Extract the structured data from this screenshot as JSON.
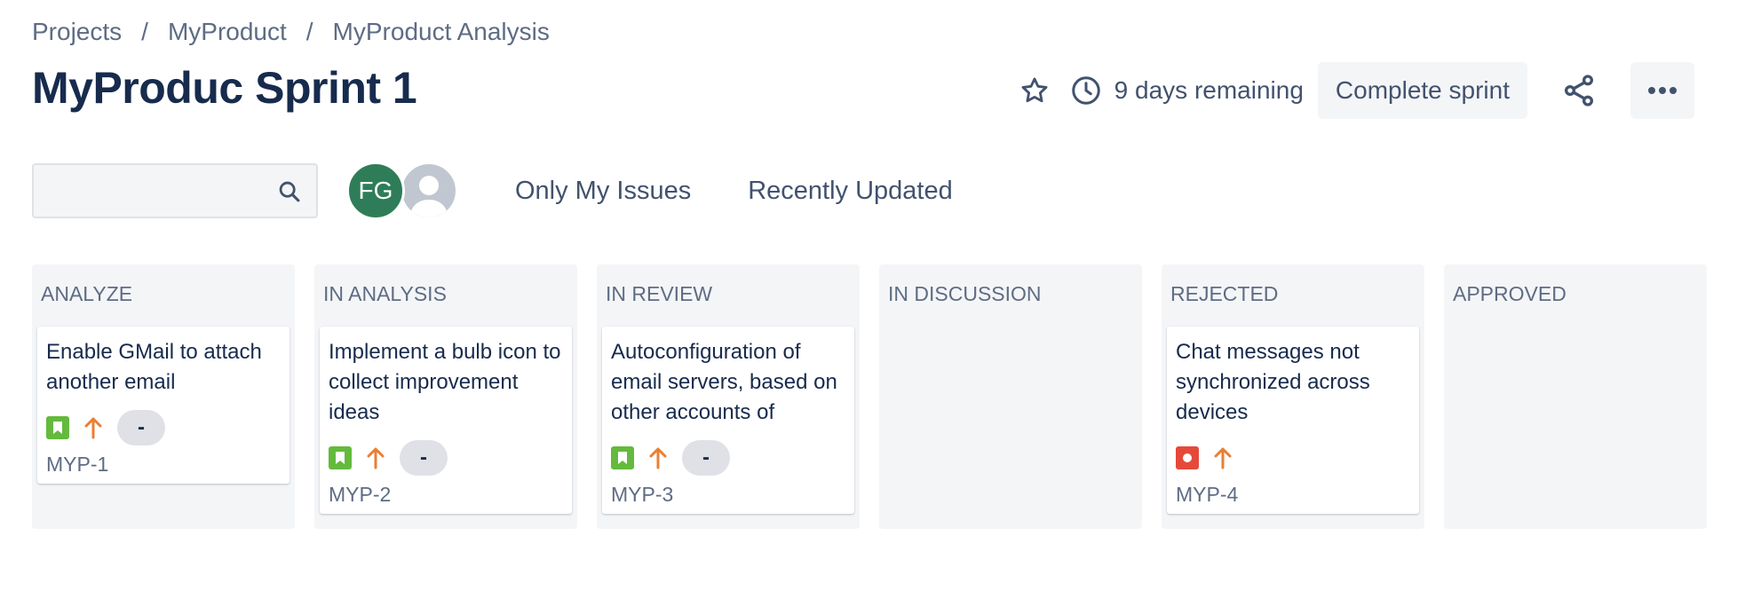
{
  "breadcrumb": {
    "items": [
      "Projects",
      "MyProduct",
      "MyProduct Analysis"
    ],
    "separator": "/"
  },
  "page_title": "MyProduc Sprint 1",
  "header": {
    "star_icon": "star-icon",
    "remaining": "9 days remaining",
    "complete_sprint": "Complete sprint",
    "share_icon": "share-icon",
    "more_icon": "more-icon"
  },
  "search": {
    "placeholder": "",
    "value": ""
  },
  "avatars": [
    {
      "initials": "FG",
      "color": "#2e7d58"
    },
    {
      "initials": "",
      "color": "#c1c7d0"
    }
  ],
  "filters": {
    "only_my_issues": "Only My Issues",
    "recently_updated": "Recently Updated"
  },
  "columns": [
    {
      "title": "ANALYZE",
      "cards": [
        {
          "title": "Enable GMail to attach another email",
          "type": "story",
          "priority": "high",
          "estimate": "-",
          "key": "MYP-1"
        }
      ]
    },
    {
      "title": "IN ANALYSIS",
      "cards": [
        {
          "title": "Implement a bulb icon to collect improvement ideas",
          "type": "story",
          "priority": "high",
          "estimate": "-",
          "key": "MYP-2"
        }
      ]
    },
    {
      "title": "IN REVIEW",
      "cards": [
        {
          "title": "Autoconfiguration of email servers, based on other accounts of",
          "type": "story",
          "priority": "high",
          "estimate": "-",
          "key": "MYP-3"
        }
      ]
    },
    {
      "title": "IN DISCUSSION",
      "cards": []
    },
    {
      "title": "REJECTED",
      "cards": [
        {
          "title": "Chat messages not synchronized across devices",
          "type": "bug",
          "priority": "high",
          "estimate": "",
          "key": "MYP-4"
        }
      ]
    },
    {
      "title": "APPROVED",
      "cards": []
    }
  ],
  "colors": {
    "story": "#63ba3c",
    "bug": "#e5493a",
    "priority_high": "#e97f33",
    "text_primary": "#172b4d",
    "text_secondary": "#5e6c84"
  }
}
